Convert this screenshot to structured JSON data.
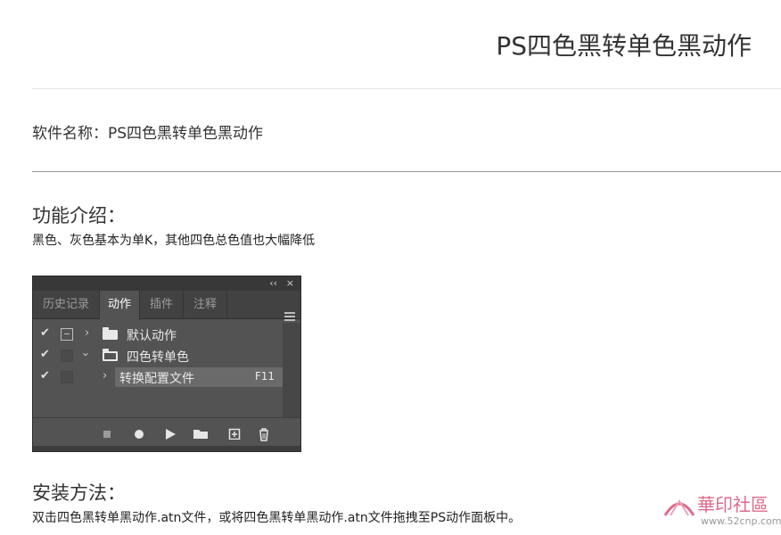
{
  "page": {
    "title": "PS四色黑转单色黑动作",
    "software_line": "软件名称：PS四色黑转单色黑动作",
    "feature_heading": "功能介绍：",
    "feature_text": "黑色、灰色基本为单K，其他四色总色值也大幅降低",
    "install_heading": "安装方法：",
    "install_text": "双击四色黑转单黑动作.atn文件，或将四色黑转单黑动作.atn文件拖拽至PS动作面板中。"
  },
  "ps_panel": {
    "titlebar_controls": [
      "‹‹",
      "×"
    ],
    "tabs": [
      {
        "label": "历史记录",
        "active": false
      },
      {
        "label": "动作",
        "active": true
      },
      {
        "label": "插件",
        "active": false
      },
      {
        "label": "注释",
        "active": false
      }
    ],
    "rows": [
      {
        "label": "默认动作",
        "type": "set",
        "expanded": false,
        "shortcut": ""
      },
      {
        "label": "四色转单色",
        "type": "set",
        "expanded": true,
        "shortcut": ""
      },
      {
        "label": "转换配置文件",
        "type": "action",
        "expanded": false,
        "shortcut": "F11"
      }
    ],
    "bottom_icons": [
      "stop-icon",
      "record-icon",
      "play-icon",
      "new-set-icon",
      "new-action-icon",
      "delete-icon"
    ]
  },
  "watermark": {
    "text": "華印社區",
    "url": "www.52cnp.com"
  }
}
